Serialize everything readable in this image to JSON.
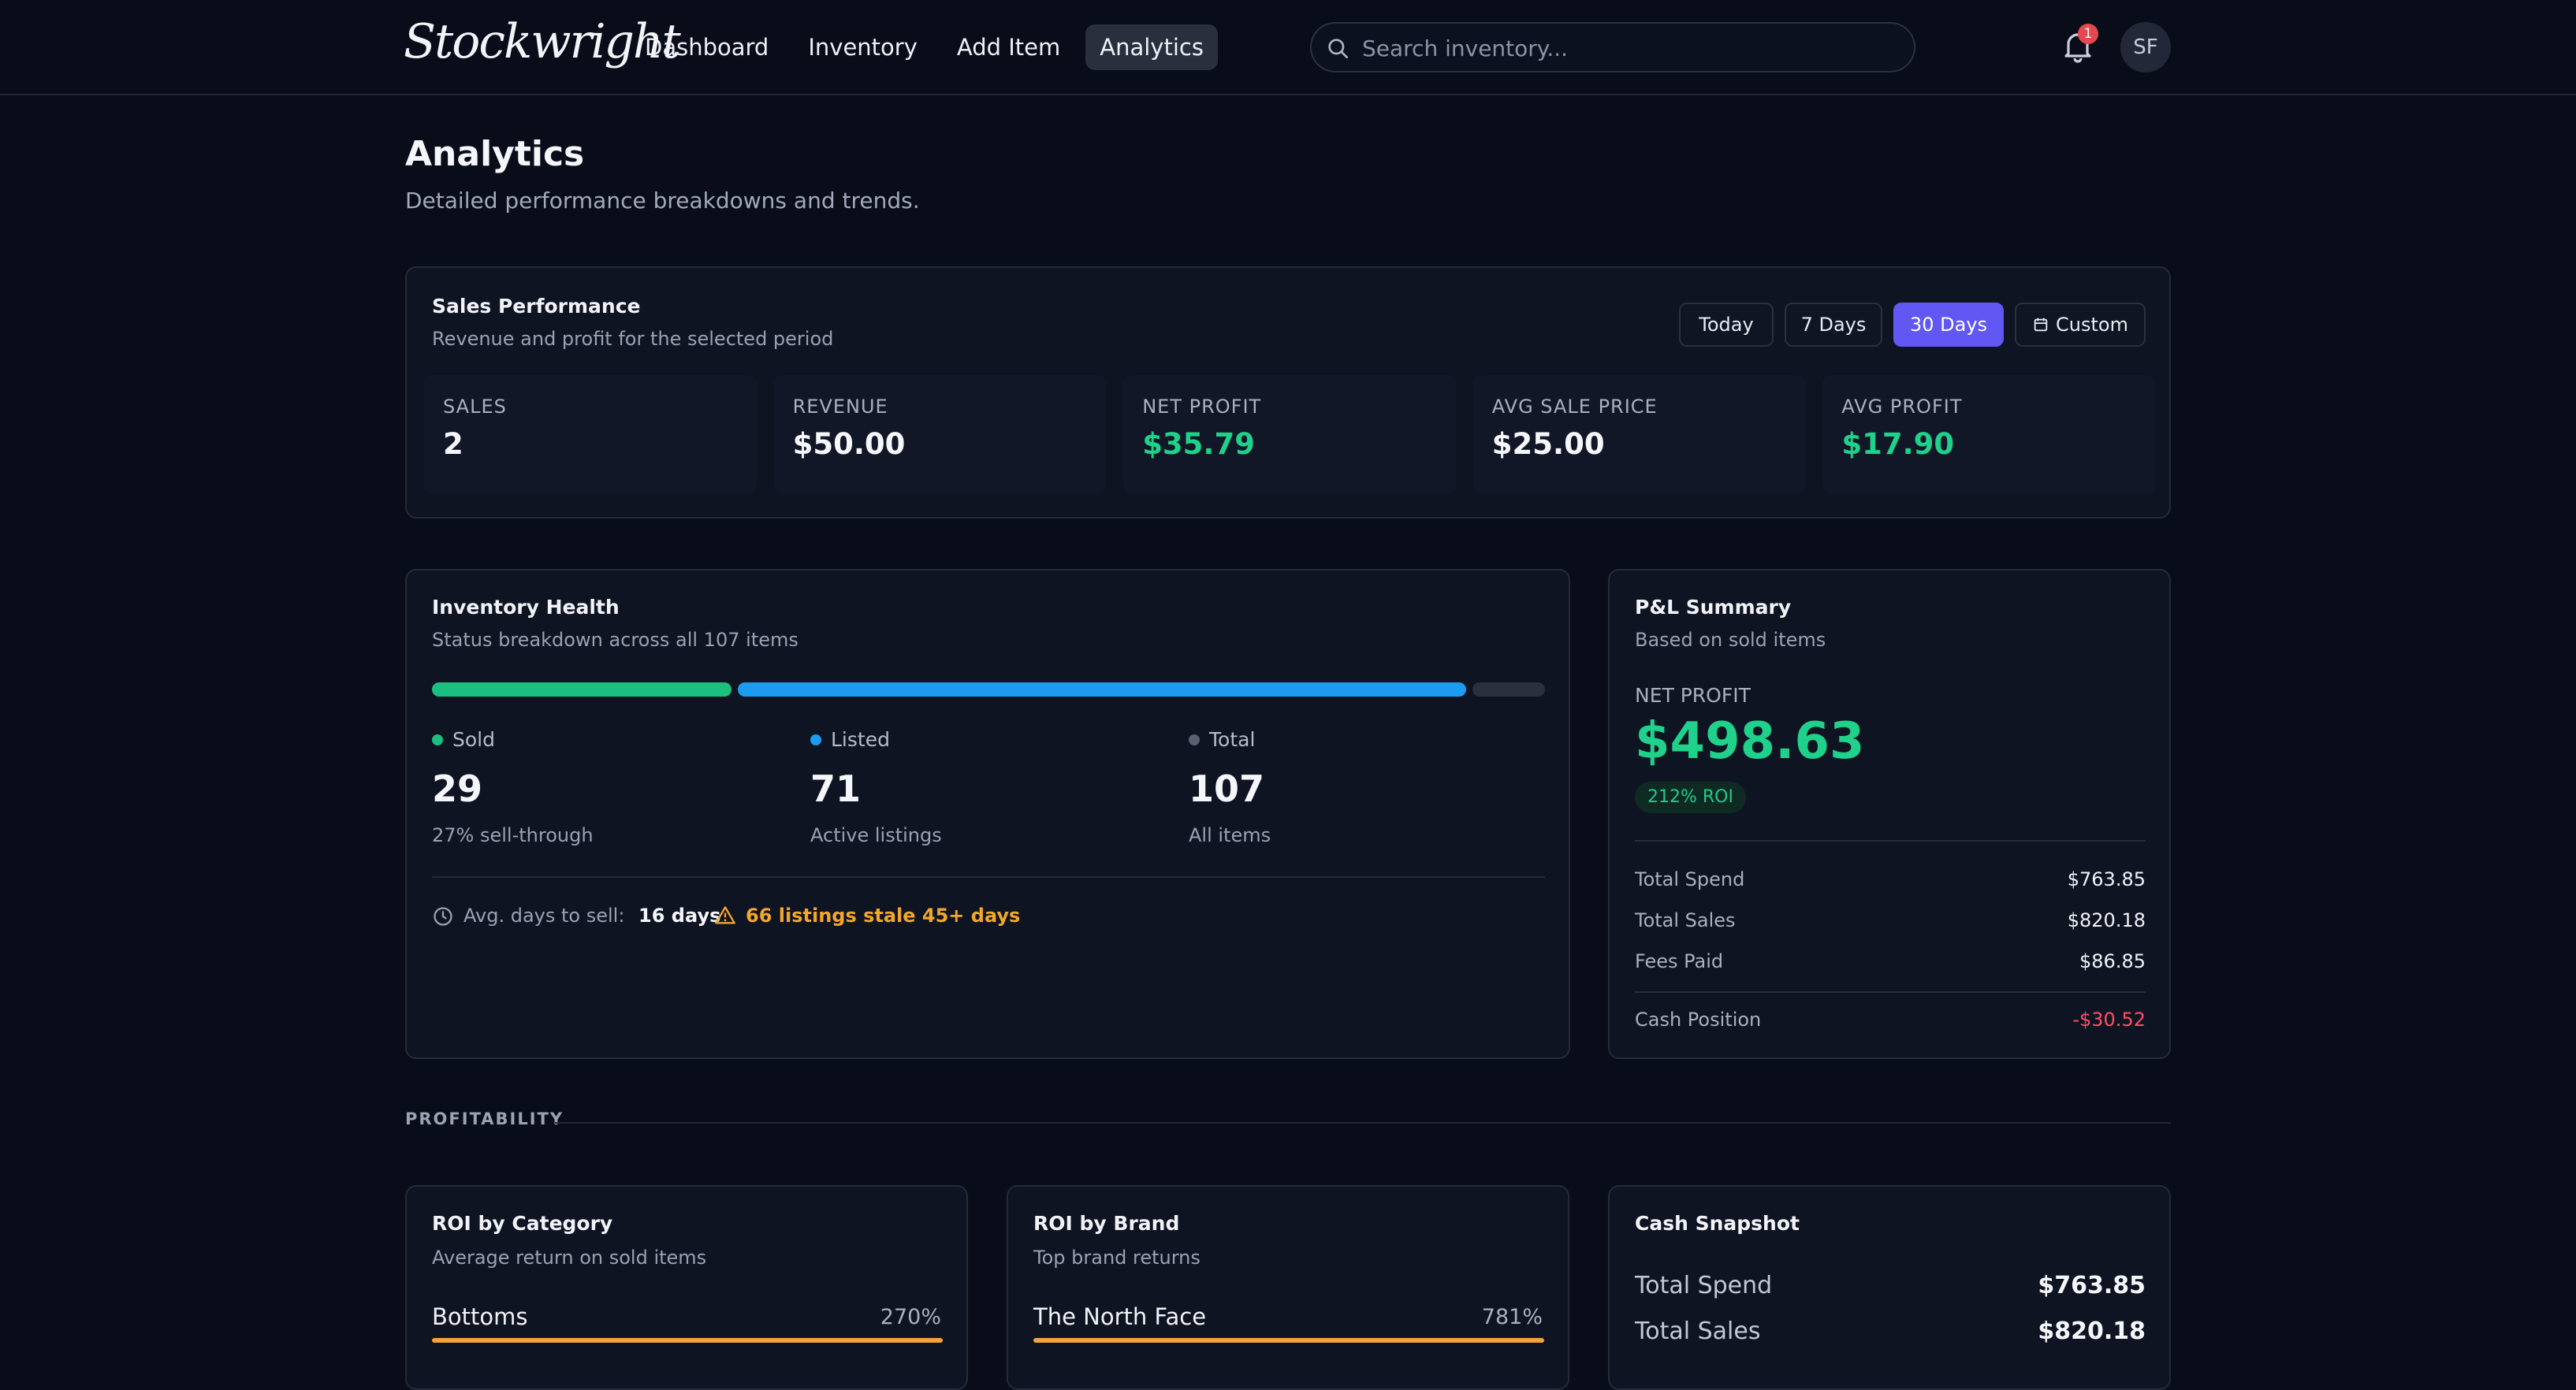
{
  "app": {
    "logo": "Stockwright"
  },
  "nav": {
    "items": [
      "Dashboard",
      "Inventory",
      "Add Item",
      "Analytics"
    ],
    "active": "Analytics"
  },
  "search": {
    "placeholder": "Search inventory..."
  },
  "notifications": {
    "count": "1"
  },
  "user": {
    "initials": "SF"
  },
  "page": {
    "title": "Analytics",
    "subtitle": "Detailed performance breakdowns and trends."
  },
  "sales": {
    "title": "Sales Performance",
    "subtitle": "Revenue and profit for the selected period",
    "periods": [
      "Today",
      "7 Days",
      "30 Days",
      "Custom"
    ],
    "active_period": "30 Days",
    "stats": [
      {
        "label": "SALES",
        "value": "2"
      },
      {
        "label": "REVENUE",
        "value": "$50.00"
      },
      {
        "label": "NET PROFIT",
        "value": "$35.79"
      },
      {
        "label": "AVG SALE PRICE",
        "value": "$25.00"
      },
      {
        "label": "AVG PROFIT",
        "value": "$17.90"
      }
    ]
  },
  "health": {
    "title": "Inventory Health",
    "subtitle": "Status breakdown across all 107 items",
    "sold": {
      "label": "Sold",
      "value": "29",
      "desc": "27% sell-through",
      "color": "#1cc07e"
    },
    "listed": {
      "label": "Listed",
      "value": "71",
      "desc": "Active listings",
      "color": "#1d9bf0"
    },
    "total": {
      "label": "Total",
      "value": "107",
      "desc": "All items",
      "color": "#5b6070"
    },
    "avg_label": "Avg. days to sell:",
    "avg_value": "16 days",
    "warning": "66 listings stale 45+ days"
  },
  "pnl": {
    "title": "P&L Summary",
    "subtitle": "Based on sold items",
    "net_label": "NET PROFIT",
    "net_value": "$498.63",
    "roi": "212% ROI",
    "rows": [
      {
        "label": "Total Spend",
        "value": "$763.85"
      },
      {
        "label": "Total Sales",
        "value": "$820.18"
      },
      {
        "label": "Fees Paid",
        "value": "$86.85"
      }
    ],
    "cash_label": "Cash Position",
    "cash_value": "-$30.52"
  },
  "profitability": {
    "section": "PROFITABILITY",
    "roi_category": {
      "title": "ROI by Category",
      "subtitle": "Average return on sold items",
      "name": "Bottoms",
      "value": "270%"
    },
    "roi_brand": {
      "title": "ROI by Brand",
      "subtitle": "Top brand returns",
      "name": "The North Face",
      "value": "781%"
    },
    "cash": {
      "title": "Cash Snapshot",
      "rows": [
        {
          "label": "Total Spend",
          "value": "$763.85"
        },
        {
          "label": "Total Sales",
          "value": "$820.18"
        }
      ]
    }
  }
}
